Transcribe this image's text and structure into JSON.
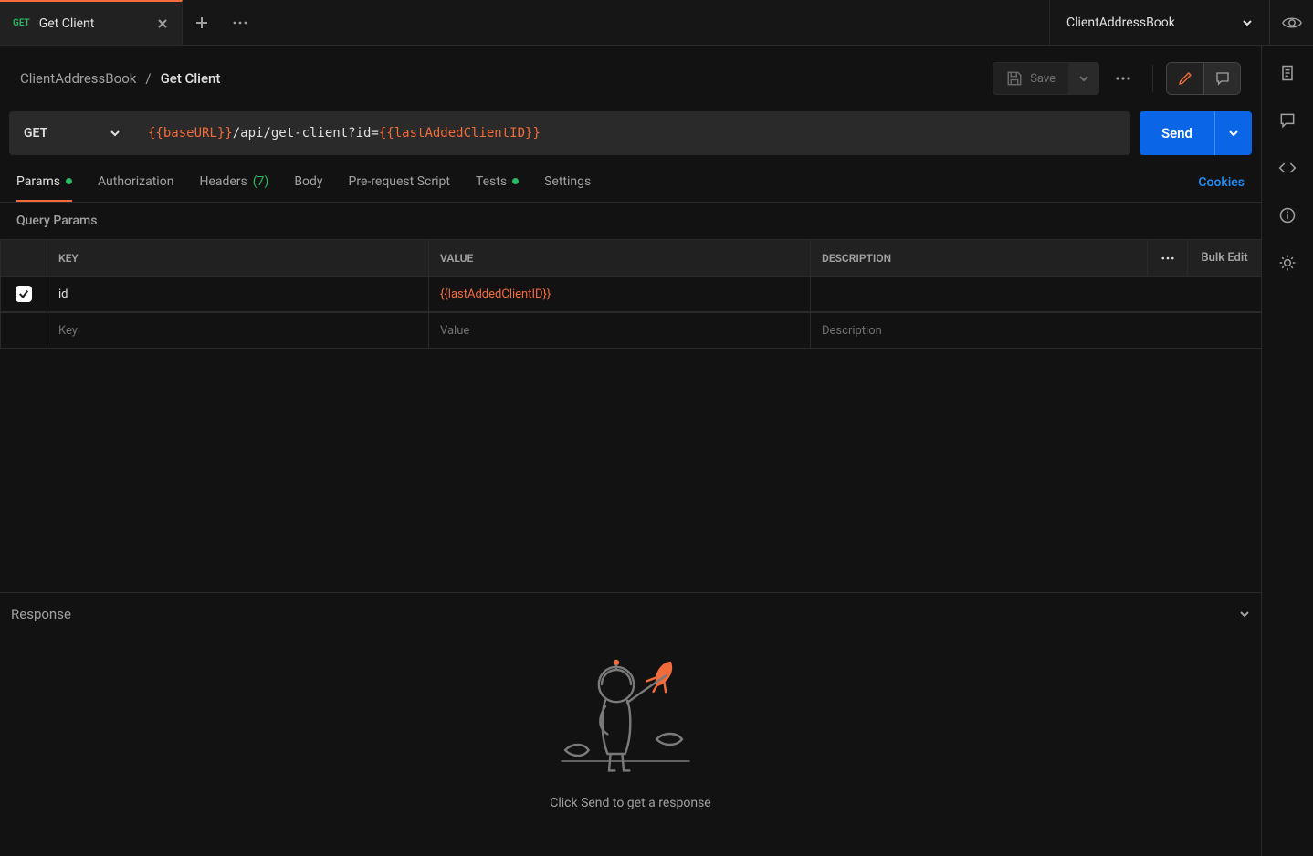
{
  "tab": {
    "method": "GET",
    "title": "Get Client"
  },
  "env": {
    "name": "ClientAddressBook"
  },
  "breadcrumb": {
    "parent": "ClientAddressBook",
    "leaf": "Get Client"
  },
  "actions": {
    "save": "Save"
  },
  "request": {
    "method": "GET",
    "url": {
      "var1": "{{baseURL}}",
      "path": "/api/get-client?id=",
      "var2": "{{lastAddedClientID}}"
    },
    "send": "Send"
  },
  "subtabs": {
    "params": "Params",
    "authorization": "Authorization",
    "headers": "Headers",
    "headers_count": "(7)",
    "body": "Body",
    "pre_request": "Pre-request Script",
    "tests": "Tests",
    "settings": "Settings",
    "cookies": "Cookies"
  },
  "params_section": {
    "label": "Query Params",
    "headers": {
      "key": "KEY",
      "value": "VALUE",
      "description": "DESCRIPTION",
      "bulk": "Bulk Edit"
    },
    "rows": [
      {
        "key": "id",
        "value": "{{lastAddedClientID}}",
        "description": ""
      }
    ],
    "placeholders": {
      "key": "Key",
      "value": "Value",
      "description": "Description"
    }
  },
  "response": {
    "label": "Response",
    "empty_msg": "Click Send to get a response"
  }
}
